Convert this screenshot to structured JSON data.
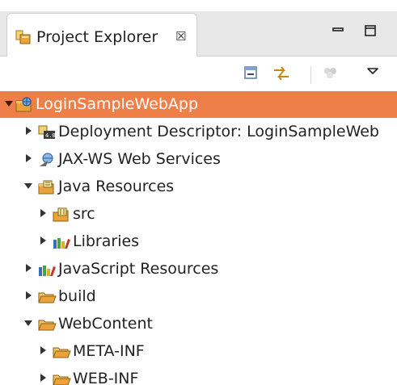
{
  "view": {
    "title": "Project Explorer",
    "close_glyph": "☒"
  },
  "window_buttons": [
    "minimize-icon",
    "maximize-icon"
  ],
  "toolbar": [
    "collapse-all-icon",
    "link-with-editor-icon",
    "filters-icon",
    "view-menu-icon"
  ],
  "colors": {
    "selection": "#ee7f48",
    "folder": "#e9a33a",
    "tab_bar": "#e8e8e8"
  },
  "tree": [
    {
      "label": "LoginSampleWebApp",
      "icon": "web-project-icon",
      "state": "expanded",
      "selected": true
    },
    {
      "label": "Deployment Descriptor: LoginSampleWeb",
      "icon": "deployment-descriptor-icon",
      "state": "collapsed"
    },
    {
      "label": "JAX-WS Web Services",
      "icon": "web-services-icon",
      "state": "collapsed"
    },
    {
      "label": "Java Resources",
      "icon": "java-resources-icon",
      "state": "expanded"
    },
    {
      "label": "src",
      "icon": "source-folder-icon",
      "state": "collapsed"
    },
    {
      "label": "Libraries",
      "icon": "libraries-icon",
      "state": "collapsed"
    },
    {
      "label": "JavaScript Resources",
      "icon": "libraries-icon",
      "state": "collapsed"
    },
    {
      "label": "build",
      "icon": "folder-icon",
      "state": "collapsed"
    },
    {
      "label": "WebContent",
      "icon": "folder-icon",
      "state": "expanded"
    },
    {
      "label": "META-INF",
      "icon": "folder-icon",
      "state": "collapsed"
    },
    {
      "label": "WEB-INF",
      "icon": "folder-icon",
      "state": "collapsed"
    }
  ]
}
